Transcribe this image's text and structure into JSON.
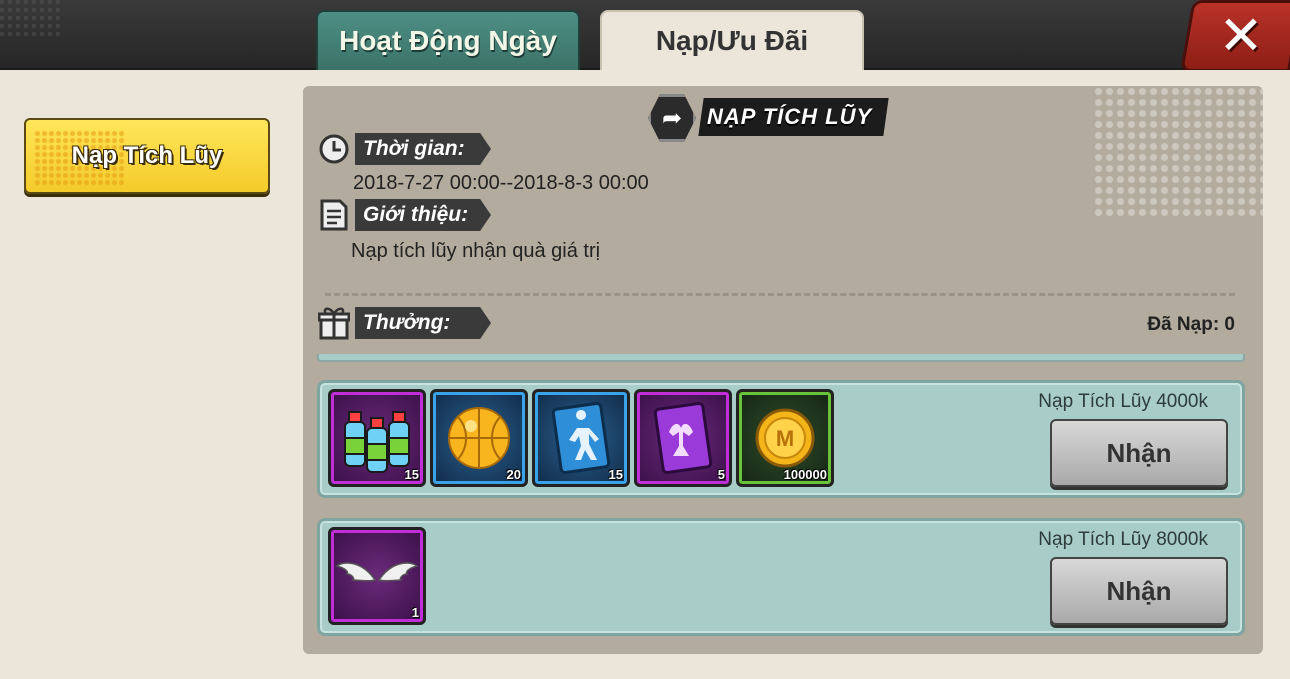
{
  "tabs": [
    {
      "label": "Hoạt Động Ngày",
      "active": false
    },
    {
      "label": "Nạp/Ưu Đãi",
      "active": true
    }
  ],
  "close_icon": "close-x-icon",
  "sidebar": {
    "items": [
      {
        "label": "Nạp Tích Lũy",
        "selected": true
      }
    ]
  },
  "event": {
    "title": "NẠP TÍCH LŨY",
    "time_label": "Thời gian:",
    "time_value": "2018-7-27 00:00--2018-8-3 00:00",
    "intro_label": "Giới thiệu:",
    "intro_value": "Nạp tích lũy nhận quà giá trị",
    "reward_label": "Thưởng:",
    "recharged": "Đã Nạp: 0"
  },
  "tiers": [
    {
      "title": "Nạp Tích Lũy 4000k",
      "button": "Nhận",
      "items": [
        {
          "icon": "energy-drink-icon",
          "quality": "purple",
          "qty": "15"
        },
        {
          "icon": "golden-basketball-icon",
          "quality": "blue",
          "qty": "20"
        },
        {
          "icon": "player-card-icon",
          "quality": "blue",
          "qty": "15"
        },
        {
          "icon": "muscle-card-icon",
          "quality": "purple",
          "qty": "5"
        },
        {
          "icon": "gold-coin-icon",
          "quality": "green",
          "qty": "100000"
        }
      ]
    },
    {
      "title": "Nạp Tích Lũy 8000k",
      "button": "Nhận",
      "items": [
        {
          "icon": "angel-wings-icon",
          "quality": "purple",
          "qty": "1"
        }
      ]
    }
  ],
  "colors": {
    "accent_yellow": "#f4cb2a",
    "panel_teal": "#a8cdc8",
    "close_red": "#b93228"
  }
}
